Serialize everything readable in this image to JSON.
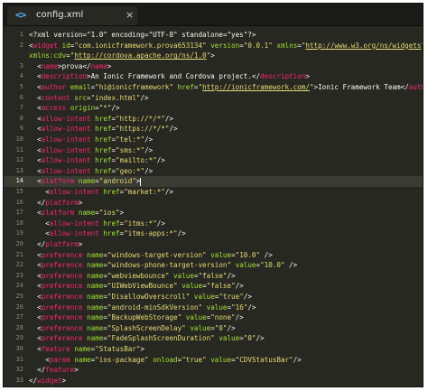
{
  "tab": {
    "icon": "code-file-icon",
    "icon_glyph": "<>",
    "title": "config.xml",
    "close_glyph": "×"
  },
  "lines": [
    {
      "n": "1",
      "parts": [
        [
          "p",
          "<?xml version=\"1.0\" encoding=\"UTF-8\" standalone=\"yes\"?>"
        ]
      ]
    },
    {
      "n": "2",
      "parts": [
        [
          "p",
          "<"
        ],
        [
          "t",
          "widget"
        ],
        [
          "p",
          " "
        ],
        [
          "a",
          "id"
        ],
        [
          "p",
          "="
        ],
        [
          "s",
          "\"com.ionicframework.prova653134\""
        ],
        [
          "p",
          " "
        ],
        [
          "a",
          "version"
        ],
        [
          "p",
          "="
        ],
        [
          "s",
          "\"0.0.1\""
        ],
        [
          "p",
          " "
        ],
        [
          "a",
          "xmlns"
        ],
        [
          "p",
          "="
        ],
        [
          "s",
          "\""
        ],
        [
          "su",
          "http://www.w3.org/ns/widgets"
        ],
        [
          "s",
          "\""
        ]
      ]
    },
    {
      "n": "",
      "parts": [
        [
          "a",
          "xmlns:cdv"
        ],
        [
          "p",
          "="
        ],
        [
          "s",
          "\""
        ],
        [
          "su",
          "http://cordova.apache.org/ns/1.0"
        ],
        [
          "s",
          "\""
        ],
        [
          "p",
          ">"
        ]
      ]
    },
    {
      "n": "3",
      "parts": [
        [
          "p",
          "  <"
        ],
        [
          "t",
          "name"
        ],
        [
          "p",
          ">prova</"
        ],
        [
          "t",
          "name"
        ],
        [
          "p",
          ">"
        ]
      ]
    },
    {
      "n": "4",
      "parts": [
        [
          "p",
          "  <"
        ],
        [
          "t",
          "description"
        ],
        [
          "p",
          ">An Ionic Framework and Cordova project.</"
        ],
        [
          "t",
          "description"
        ],
        [
          "p",
          ">"
        ]
      ]
    },
    {
      "n": "5",
      "parts": [
        [
          "p",
          "  <"
        ],
        [
          "t",
          "author"
        ],
        [
          "p",
          " "
        ],
        [
          "a",
          "email"
        ],
        [
          "p",
          "="
        ],
        [
          "s",
          "\"hi@ionicframework\""
        ],
        [
          "p",
          " "
        ],
        [
          "a",
          "href"
        ],
        [
          "p",
          "="
        ],
        [
          "s",
          "\""
        ],
        [
          "su",
          "http://ionicframework.com/"
        ],
        [
          "s",
          "\""
        ],
        [
          "p",
          ">Ionic Framework Team</"
        ],
        [
          "t",
          "author"
        ],
        [
          "p",
          ">"
        ]
      ]
    },
    {
      "n": "6",
      "parts": [
        [
          "p",
          "  <"
        ],
        [
          "t",
          "content"
        ],
        [
          "p",
          " "
        ],
        [
          "a",
          "src"
        ],
        [
          "p",
          "="
        ],
        [
          "s",
          "\"index.html\""
        ],
        [
          "p",
          "/>"
        ]
      ]
    },
    {
      "n": "7",
      "parts": [
        [
          "p",
          "  <"
        ],
        [
          "t",
          "access"
        ],
        [
          "p",
          " "
        ],
        [
          "a",
          "origin"
        ],
        [
          "p",
          "="
        ],
        [
          "s",
          "\"*\""
        ],
        [
          "p",
          "/>"
        ]
      ]
    },
    {
      "n": "8",
      "parts": [
        [
          "p",
          "  <"
        ],
        [
          "t",
          "allow-intent"
        ],
        [
          "p",
          " "
        ],
        [
          "a",
          "href"
        ],
        [
          "p",
          "="
        ],
        [
          "s",
          "\"http://*/*\""
        ],
        [
          "p",
          "/>"
        ]
      ]
    },
    {
      "n": "9",
      "parts": [
        [
          "p",
          "  <"
        ],
        [
          "t",
          "allow-intent"
        ],
        [
          "p",
          " "
        ],
        [
          "a",
          "href"
        ],
        [
          "p",
          "="
        ],
        [
          "s",
          "\"https://*/*\""
        ],
        [
          "p",
          "/>"
        ]
      ]
    },
    {
      "n": "10",
      "parts": [
        [
          "p",
          "  <"
        ],
        [
          "t",
          "allow-intent"
        ],
        [
          "p",
          " "
        ],
        [
          "a",
          "href"
        ],
        [
          "p",
          "="
        ],
        [
          "s",
          "\"tel:*\""
        ],
        [
          "p",
          "/>"
        ]
      ]
    },
    {
      "n": "11",
      "parts": [
        [
          "p",
          "  <"
        ],
        [
          "t",
          "allow-intent"
        ],
        [
          "p",
          " "
        ],
        [
          "a",
          "href"
        ],
        [
          "p",
          "="
        ],
        [
          "s",
          "\"sms:*\""
        ],
        [
          "p",
          "/>"
        ]
      ]
    },
    {
      "n": "12",
      "parts": [
        [
          "p",
          "  <"
        ],
        [
          "t",
          "allow-intent"
        ],
        [
          "p",
          " "
        ],
        [
          "a",
          "href"
        ],
        [
          "p",
          "="
        ],
        [
          "s",
          "\"mailto:*\""
        ],
        [
          "p",
          "/>"
        ]
      ]
    },
    {
      "n": "13",
      "parts": [
        [
          "p",
          "  <"
        ],
        [
          "t",
          "allow-intent"
        ],
        [
          "p",
          " "
        ],
        [
          "a",
          "href"
        ],
        [
          "p",
          "="
        ],
        [
          "s",
          "\"geo:*\""
        ],
        [
          "p",
          "/>"
        ]
      ]
    },
    {
      "n": "14",
      "active": true,
      "parts": [
        [
          "p",
          "  <"
        ],
        [
          "t",
          "platform"
        ],
        [
          "p",
          " "
        ],
        [
          "a",
          "name"
        ],
        [
          "p",
          "="
        ],
        [
          "s",
          "\"android\""
        ],
        [
          "p",
          ">"
        ]
      ],
      "caret": true
    },
    {
      "n": "15",
      "parts": [
        [
          "p",
          "    <"
        ],
        [
          "t",
          "allow-intent"
        ],
        [
          "p",
          " "
        ],
        [
          "a",
          "href"
        ],
        [
          "p",
          "="
        ],
        [
          "s",
          "\"market:*\""
        ],
        [
          "p",
          "/>"
        ]
      ]
    },
    {
      "n": "16",
      "parts": [
        [
          "p",
          "  </"
        ],
        [
          "t",
          "platform"
        ],
        [
          "p",
          ">"
        ]
      ]
    },
    {
      "n": "17",
      "parts": [
        [
          "p",
          "  <"
        ],
        [
          "t",
          "platform"
        ],
        [
          "p",
          " "
        ],
        [
          "a",
          "name"
        ],
        [
          "p",
          "="
        ],
        [
          "s",
          "\"ios\""
        ],
        [
          "p",
          ">"
        ]
      ]
    },
    {
      "n": "18",
      "parts": [
        [
          "p",
          "    <"
        ],
        [
          "t",
          "allow-intent"
        ],
        [
          "p",
          " "
        ],
        [
          "a",
          "href"
        ],
        [
          "p",
          "="
        ],
        [
          "s",
          "\"itms:*\""
        ],
        [
          "p",
          "/>"
        ]
      ]
    },
    {
      "n": "19",
      "parts": [
        [
          "p",
          "    <"
        ],
        [
          "t",
          "allow-intent"
        ],
        [
          "p",
          " "
        ],
        [
          "a",
          "href"
        ],
        [
          "p",
          "="
        ],
        [
          "s",
          "\"itms-apps:*\""
        ],
        [
          "p",
          "/>"
        ]
      ]
    },
    {
      "n": "20",
      "parts": [
        [
          "p",
          "  </"
        ],
        [
          "t",
          "platform"
        ],
        [
          "p",
          ">"
        ]
      ]
    },
    {
      "n": "21",
      "parts": [
        [
          "p",
          "  <"
        ],
        [
          "t",
          "preference"
        ],
        [
          "p",
          " "
        ],
        [
          "a",
          "name"
        ],
        [
          "p",
          "="
        ],
        [
          "s",
          "\"windows-target-version\""
        ],
        [
          "p",
          " "
        ],
        [
          "a",
          "value"
        ],
        [
          "p",
          "="
        ],
        [
          "s",
          "\"10.0\""
        ],
        [
          "p",
          " />"
        ]
      ]
    },
    {
      "n": "22",
      "parts": [
        [
          "p",
          "  <"
        ],
        [
          "t",
          "preference"
        ],
        [
          "p",
          " "
        ],
        [
          "a",
          "name"
        ],
        [
          "p",
          "="
        ],
        [
          "s",
          "\"windows-phone-target-version\""
        ],
        [
          "p",
          " "
        ],
        [
          "a",
          "value"
        ],
        [
          "p",
          "="
        ],
        [
          "s",
          "\"10.0\""
        ],
        [
          "p",
          " />"
        ]
      ]
    },
    {
      "n": "23",
      "parts": [
        [
          "p",
          "  <"
        ],
        [
          "t",
          "preference"
        ],
        [
          "p",
          " "
        ],
        [
          "a",
          "name"
        ],
        [
          "p",
          "="
        ],
        [
          "s",
          "\"webviewbounce\""
        ],
        [
          "p",
          " "
        ],
        [
          "a",
          "value"
        ],
        [
          "p",
          "="
        ],
        [
          "s",
          "\"false\""
        ],
        [
          "p",
          "/>"
        ]
      ]
    },
    {
      "n": "24",
      "parts": [
        [
          "p",
          "  <"
        ],
        [
          "t",
          "preference"
        ],
        [
          "p",
          " "
        ],
        [
          "a",
          "name"
        ],
        [
          "p",
          "="
        ],
        [
          "s",
          "\"UIWebViewBounce\""
        ],
        [
          "p",
          " "
        ],
        [
          "a",
          "value"
        ],
        [
          "p",
          "="
        ],
        [
          "s",
          "\"false\""
        ],
        [
          "p",
          "/>"
        ]
      ]
    },
    {
      "n": "25",
      "parts": [
        [
          "p",
          "  <"
        ],
        [
          "t",
          "preference"
        ],
        [
          "p",
          " "
        ],
        [
          "a",
          "name"
        ],
        [
          "p",
          "="
        ],
        [
          "s",
          "\"DisallowOverscroll\""
        ],
        [
          "p",
          " "
        ],
        [
          "a",
          "value"
        ],
        [
          "p",
          "="
        ],
        [
          "s",
          "\"true\""
        ],
        [
          "p",
          "/>"
        ]
      ]
    },
    {
      "n": "26",
      "parts": [
        [
          "p",
          "  <"
        ],
        [
          "t",
          "preference"
        ],
        [
          "p",
          " "
        ],
        [
          "a",
          "name"
        ],
        [
          "p",
          "="
        ],
        [
          "s",
          "\"android-minSdkVersion\""
        ],
        [
          "p",
          " "
        ],
        [
          "a",
          "value"
        ],
        [
          "p",
          "="
        ],
        [
          "s",
          "\"16\""
        ],
        [
          "p",
          "/>"
        ]
      ]
    },
    {
      "n": "27",
      "parts": [
        [
          "p",
          "  <"
        ],
        [
          "t",
          "preference"
        ],
        [
          "p",
          " "
        ],
        [
          "a",
          "name"
        ],
        [
          "p",
          "="
        ],
        [
          "s",
          "\"BackupWebStorage\""
        ],
        [
          "p",
          " "
        ],
        [
          "a",
          "value"
        ],
        [
          "p",
          "="
        ],
        [
          "s",
          "\"none\""
        ],
        [
          "p",
          "/>"
        ]
      ]
    },
    {
      "n": "28",
      "parts": [
        [
          "p",
          "  <"
        ],
        [
          "t",
          "preference"
        ],
        [
          "p",
          " "
        ],
        [
          "a",
          "name"
        ],
        [
          "p",
          "="
        ],
        [
          "s",
          "\"SplashScreenDelay\""
        ],
        [
          "p",
          " "
        ],
        [
          "a",
          "value"
        ],
        [
          "p",
          "="
        ],
        [
          "s",
          "\"0\""
        ],
        [
          "p",
          "/>"
        ]
      ]
    },
    {
      "n": "29",
      "parts": [
        [
          "p",
          "  <"
        ],
        [
          "t",
          "preference"
        ],
        [
          "p",
          " "
        ],
        [
          "a",
          "name"
        ],
        [
          "p",
          "="
        ],
        [
          "s",
          "\"FadeSplashScreenDuration\""
        ],
        [
          "p",
          " "
        ],
        [
          "a",
          "value"
        ],
        [
          "p",
          "="
        ],
        [
          "s",
          "\"0\""
        ],
        [
          "p",
          "/>"
        ]
      ]
    },
    {
      "n": "30",
      "parts": [
        [
          "p",
          "  <"
        ],
        [
          "t",
          "feature"
        ],
        [
          "p",
          " "
        ],
        [
          "a",
          "name"
        ],
        [
          "p",
          "="
        ],
        [
          "s",
          "\"StatusBar\""
        ],
        [
          "p",
          ">"
        ]
      ]
    },
    {
      "n": "31",
      "parts": [
        [
          "p",
          "    <"
        ],
        [
          "t",
          "param"
        ],
        [
          "p",
          " "
        ],
        [
          "a",
          "name"
        ],
        [
          "p",
          "="
        ],
        [
          "s",
          "\"ios-package\""
        ],
        [
          "p",
          " "
        ],
        [
          "a",
          "onload"
        ],
        [
          "p",
          "="
        ],
        [
          "s",
          "\"true\""
        ],
        [
          "p",
          " "
        ],
        [
          "a",
          "value"
        ],
        [
          "p",
          "="
        ],
        [
          "s",
          "\"CDVStatusBar\""
        ],
        [
          "p",
          "/>"
        ]
      ]
    },
    {
      "n": "32",
      "parts": [
        [
          "p",
          "  </"
        ],
        [
          "t",
          "feature"
        ],
        [
          "p",
          ">"
        ]
      ]
    },
    {
      "n": "33",
      "parts": [
        [
          "p",
          "</"
        ],
        [
          "t",
          "widget"
        ],
        [
          "p",
          ">"
        ]
      ]
    }
  ],
  "colors": {
    "background": "#272822",
    "tag": "#f92672",
    "attribute": "#a6e22e",
    "string": "#e6db74",
    "text": "#f8f8f2"
  }
}
